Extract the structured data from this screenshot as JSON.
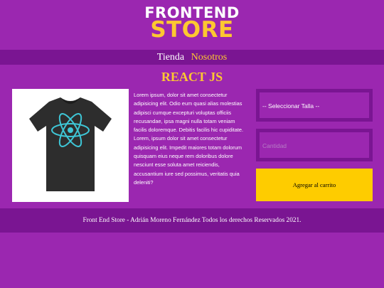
{
  "logo": {
    "line1": "FRONTEND",
    "line2": "STORE"
  },
  "nav": {
    "items": [
      {
        "label": "Tienda"
      },
      {
        "label": "Nosotros"
      }
    ]
  },
  "product": {
    "title": "REACT JS",
    "description": "Lorem ipsum, dolor sit amet consectetur adipisicing elit. Odio eum quasi alias molestias adipisci cumque excepturi voluptas officiis recusandae, ipsa magni nulla totam veniam facilis doloremque. Debitis facilis hic cupiditate. Lorem, ipsum dolor sit amet consectetur adipisicing elit. Impedit maiores totam dolorum quisquam eius neque rem doloribus dolore nesciunt esse soluta amet reiciendis, accusantium iure sed possimus, veritatis quia deleniti?",
    "image_icon": "react-tshirt-image"
  },
  "form": {
    "size_select": "-- Seleccionar Talla --",
    "quantity_placeholder": "Cantidad",
    "add_to_cart": "Agregar al carrito"
  },
  "footer": {
    "text": "Front End Store - Adrián Moreno Fernández Todos los derechos Reservados 2021."
  },
  "colors": {
    "background": "#9b27b0",
    "bar": "#7a1592",
    "accent": "#fdc830",
    "button": "#fecc00"
  }
}
